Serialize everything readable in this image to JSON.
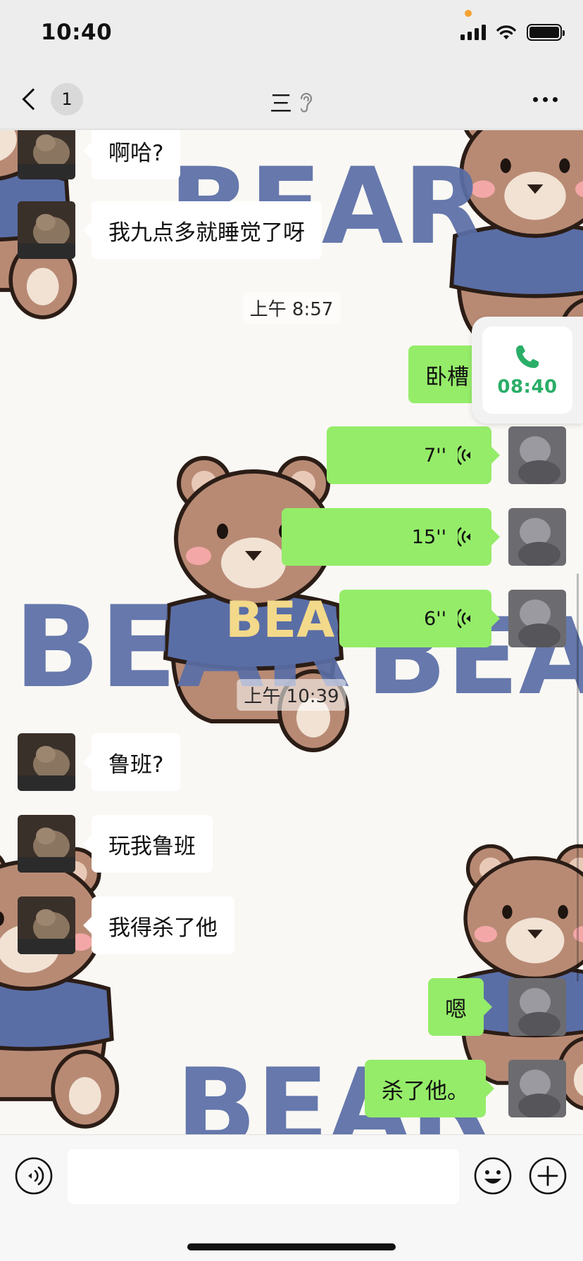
{
  "status_bar": {
    "time": "10:40"
  },
  "nav": {
    "unread_count": "1",
    "title": "三"
  },
  "messages": [
    {
      "side": "in",
      "text": "啊哈?"
    },
    {
      "side": "in",
      "text": "我九点多就睡觉了呀"
    },
    {
      "type": "time",
      "text": "上午 8:57"
    },
    {
      "side": "out",
      "text": "卧槽"
    },
    {
      "side": "out",
      "type": "voice",
      "duration": "7''"
    },
    {
      "side": "out",
      "type": "voice",
      "duration": "15''"
    },
    {
      "side": "out",
      "type": "voice",
      "duration": "6''"
    },
    {
      "type": "time",
      "text": "上午 10:39"
    },
    {
      "side": "in",
      "text": "鲁班?"
    },
    {
      "side": "in",
      "text": "玩我鲁班"
    },
    {
      "side": "in",
      "text": "我得杀了他"
    },
    {
      "side": "out",
      "text": "嗯"
    },
    {
      "side": "out",
      "text": "杀了他。"
    }
  ],
  "call_widget": {
    "timer": "08:40"
  },
  "wallpaper": {
    "words": [
      "BEAR",
      "BEAR",
      "BEAR",
      "BEAR",
      "BEAR"
    ]
  },
  "input_bar": {
    "value": ""
  },
  "colors": {
    "outgoing_bubble": "#95ec69",
    "incoming_bubble": "#ffffff",
    "call_green": "#2aae67",
    "wallpaper_text": "#5a6ea6",
    "bear_brown": "#b88a74"
  },
  "icons": [
    "back-icon",
    "ear-icon",
    "more-icon",
    "phone-icon",
    "voice-icon",
    "voice-toggle-icon",
    "emoji-icon",
    "plus-icon"
  ]
}
